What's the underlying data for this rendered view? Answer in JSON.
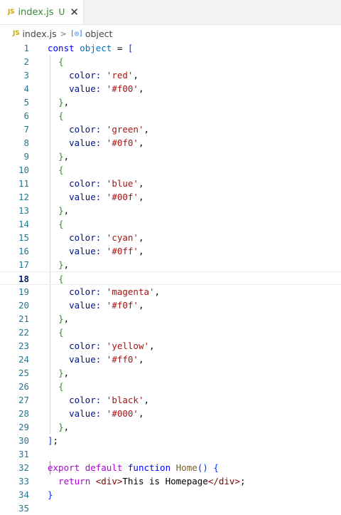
{
  "tab": {
    "badge": "JS",
    "name": "index.js",
    "status": "U",
    "close": "✕"
  },
  "breadcrumb": {
    "badge": "JS",
    "file": "index.js",
    "separator": ">",
    "symbol_icon": "[◎]",
    "symbol": "object"
  },
  "editor": {
    "current_line": 18,
    "lines": [
      {
        "n": "1"
      },
      {
        "n": "2"
      },
      {
        "n": "3"
      },
      {
        "n": "4"
      },
      {
        "n": "5"
      },
      {
        "n": "6"
      },
      {
        "n": "7"
      },
      {
        "n": "8"
      },
      {
        "n": "9"
      },
      {
        "n": "10"
      },
      {
        "n": "11"
      },
      {
        "n": "12"
      },
      {
        "n": "13"
      },
      {
        "n": "14"
      },
      {
        "n": "15"
      },
      {
        "n": "16"
      },
      {
        "n": "17"
      },
      {
        "n": "18"
      },
      {
        "n": "19"
      },
      {
        "n": "20"
      },
      {
        "n": "21"
      },
      {
        "n": "22"
      },
      {
        "n": "23"
      },
      {
        "n": "24"
      },
      {
        "n": "25"
      },
      {
        "n": "26"
      },
      {
        "n": "27"
      },
      {
        "n": "28"
      },
      {
        "n": "29"
      },
      {
        "n": "30"
      },
      {
        "n": "31"
      },
      {
        "n": "32"
      },
      {
        "n": "33"
      },
      {
        "n": "34"
      },
      {
        "n": "35"
      }
    ],
    "tokens": {
      "const": "const",
      "object": "object",
      "eq": " = ",
      "open_bracket": "[",
      "close_bracket": "]",
      "semicolon": ";",
      "open_brace": "{",
      "close_brace": "}",
      "close_brace_comma": "},",
      "comma": ",",
      "color_key": "color: ",
      "value_key": "value: ",
      "export": "export",
      "default": "default",
      "function": "function",
      "home": "Home",
      "parens": "()",
      "return": "return",
      "div_open": "<div>",
      "div_text": "This is Homepage",
      "div_close": "</div>"
    },
    "entries": [
      {
        "color": "'red'",
        "value": "'#f00'"
      },
      {
        "color": "'green'",
        "value": "'#0f0'"
      },
      {
        "color": "'blue'",
        "value": "'#00f'"
      },
      {
        "color": "'cyan'",
        "value": "'#0ff'"
      },
      {
        "color": "'magenta'",
        "value": "'#f0f'"
      },
      {
        "color": "'yellow'",
        "value": "'#ff0'"
      },
      {
        "color": "'black'",
        "value": "'#000'"
      }
    ]
  }
}
